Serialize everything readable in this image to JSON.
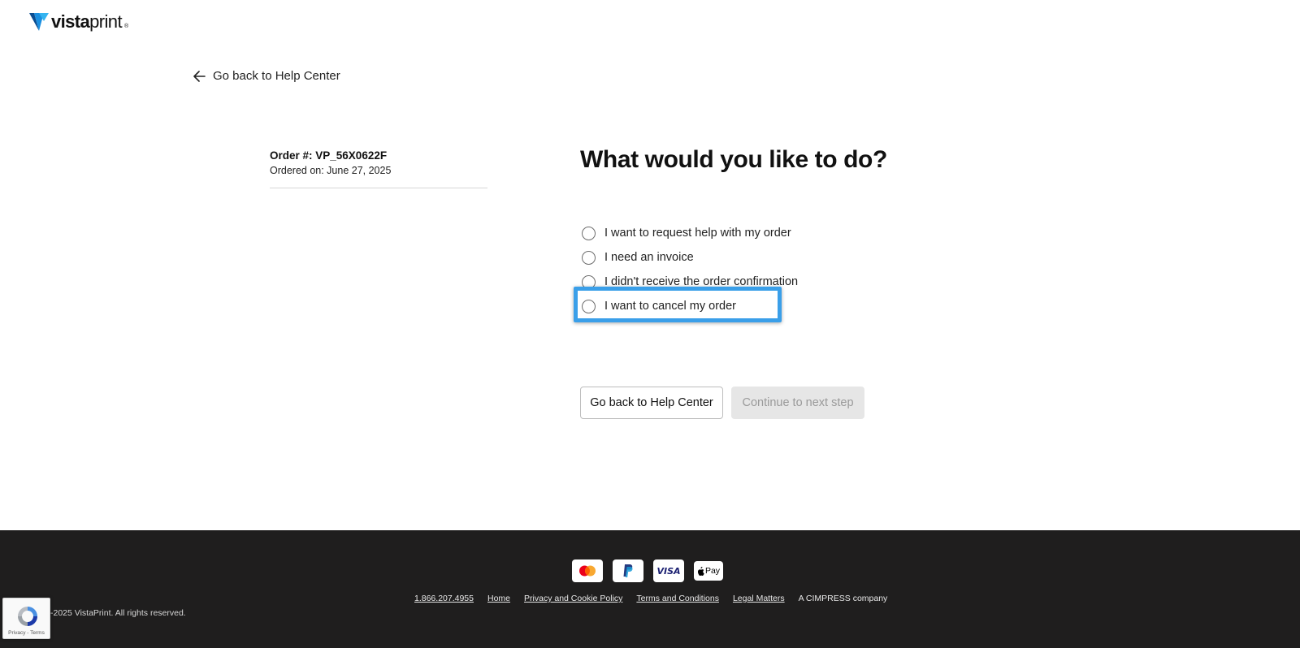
{
  "header": {
    "logo_bold": "vista",
    "logo_light": "print",
    "logo_reg": "®"
  },
  "nav": {
    "back_link": "Go back to Help Center"
  },
  "order": {
    "number": "Order #: VP_56X0622F",
    "date": "Ordered on: June 27, 2025"
  },
  "main": {
    "title": "What would you like to do?",
    "options": [
      {
        "label": "I want to request help with my order",
        "selected": false
      },
      {
        "label": "I need an invoice",
        "selected": false
      },
      {
        "label": "I didn't receive the order confirmation",
        "selected": false
      },
      {
        "label": "I want to cancel my order",
        "selected": false,
        "highlighted": true
      }
    ],
    "back_button": "Go back to Help Center",
    "continue_button": "Continue to next step"
  },
  "footer": {
    "payment_methods": [
      "mastercard-icon",
      "paypal-icon",
      "visa-icon",
      "apple-pay-icon"
    ],
    "visa_label": "VISA",
    "apple_pay_label": "Pay",
    "links": [
      "1.866.207.4955",
      "Home",
      "Privacy and Cookie Policy",
      "Terms and Conditions",
      "Legal Matters"
    ],
    "company": "A CIMPRESS company",
    "copyright": "-2025 VistaPrint. All rights reserved."
  },
  "recaptcha": {
    "links": "Privacy - Terms"
  },
  "colors": {
    "highlight": "#3a9fe9",
    "footer_bg": "#1f1e1e",
    "logo_mark": "#1a6fc4"
  }
}
